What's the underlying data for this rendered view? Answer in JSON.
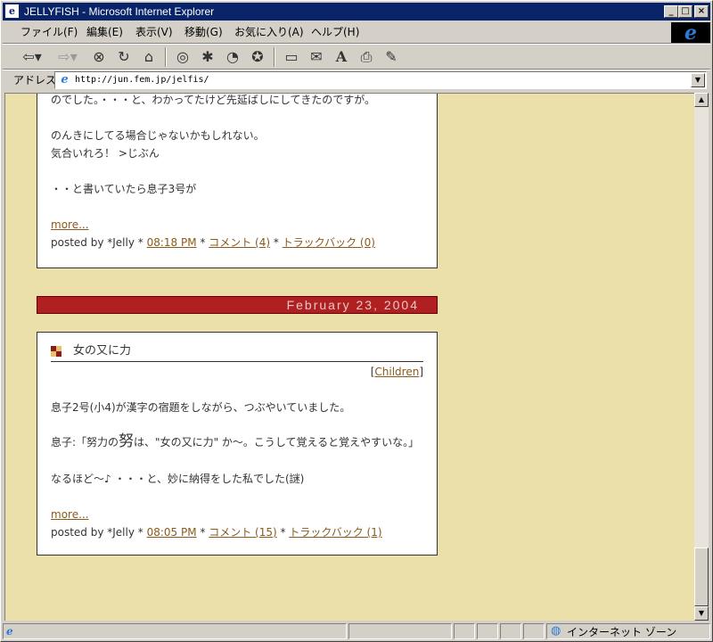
{
  "window": {
    "title": "JELLYFISH - Microsoft Internet Explorer",
    "minimize_glyph": "_",
    "maximize_glyph": "□",
    "close_glyph": "×"
  },
  "menu": {
    "items": [
      "ファイル(F)",
      "編集(E)",
      "表示(V)",
      "移動(G)",
      "お気に入り(A)",
      "ヘルプ(H)"
    ]
  },
  "toolbar": {
    "icons": [
      "back-icon",
      "forward-icon",
      "stop-icon",
      "refresh-icon",
      "home-icon",
      "search-icon",
      "favorites-icon",
      "history-icon",
      "channels-icon",
      "fullscreen-icon",
      "mail-icon",
      "font-icon",
      "print-icon",
      "edit-icon"
    ]
  },
  "address": {
    "label": "アドレス",
    "url": "http://jun.fem.jp/jelfis/"
  },
  "post1": {
    "lines": [
      "のでした。・・・と、わかってたけど先延ばしにしてきたのですが。",
      "のんきにしてる場合じゃないかもしれない。",
      "気合いれろ！ >じぶん",
      "・・と書いていたら息子3号が"
    ],
    "more": "more...",
    "posted_by": "posted by *Jelly * ",
    "time": "08:18 PM",
    "sep": " * ",
    "comments": "コメント (4)",
    "trackback": "トラックバック (0)"
  },
  "date_header": "February 23, 2004",
  "post2": {
    "title": "女の又に力",
    "category_open": "[",
    "category": "Children",
    "category_close": "]",
    "line1": "息子2号(小4)が漢字の宿題をしながら、つぶやいていました。",
    "line2a": "息子:「努力の",
    "line2b": "努",
    "line2c": "は、\"女の又に力\" か〜。こうして覚えると覚えやすいな。」",
    "line3": "なるほど〜♪ ・・・と、妙に納得をした私でした(謎)",
    "more": "more...",
    "posted_by": "posted by *Jelly * ",
    "time": "08:05 PM",
    "sep": " * ",
    "comments": "コメント (15)",
    "trackback": "トラックバック (1)"
  },
  "status": {
    "zone": "インターネット ゾーン"
  },
  "colors": {
    "page_bg": "#ece0aa",
    "date_bar": "#b02020",
    "link": "#8a5a1a",
    "titlebar": "#0a246a"
  }
}
